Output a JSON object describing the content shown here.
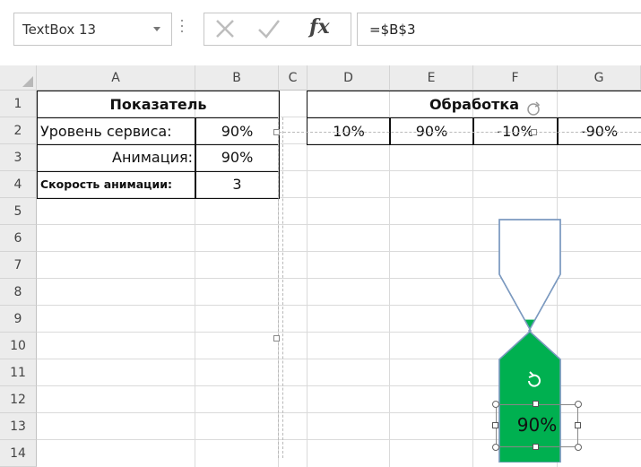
{
  "formula_bar": {
    "name_box": "TextBox 13",
    "formula": "=$B$3",
    "fx_label": "fx"
  },
  "columns": [
    "A",
    "B",
    "C",
    "D",
    "E",
    "F",
    "G"
  ],
  "rows": [
    "1",
    "2",
    "3",
    "4",
    "5",
    "6",
    "7",
    "8",
    "9",
    "10",
    "11",
    "12",
    "13",
    "14"
  ],
  "table_left": {
    "header": "Показатель",
    "rows": [
      {
        "label": "Уровень сервиса:",
        "value": "90%"
      },
      {
        "label": "Анимация:",
        "value": "90%"
      },
      {
        "label": "Скорость анимации:",
        "value": "3"
      }
    ]
  },
  "table_right": {
    "header": "Обработка",
    "values": [
      "10%",
      "90%",
      "-10%",
      "-90%"
    ]
  },
  "hourglass": {
    "fill_color": "#00b050",
    "outline_color": "#7c9ac0",
    "fill_level": 0.9,
    "textbox_value": "90%"
  }
}
